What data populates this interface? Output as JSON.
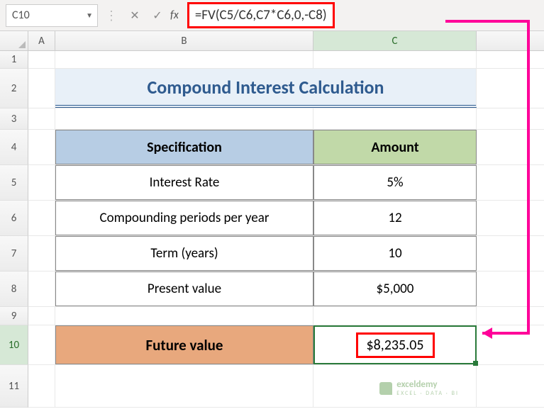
{
  "nameBox": {
    "value": "C10"
  },
  "formulaBar": {
    "formula": "=FV(C5/C6,C7*C6,0,-C8)"
  },
  "columns": {
    "A": "A",
    "B": "B",
    "C": "C"
  },
  "rows": [
    "1",
    "2",
    "3",
    "4",
    "5",
    "6",
    "7",
    "8",
    "9",
    "10",
    "11"
  ],
  "title": "Compound Interest Calculation",
  "headers": {
    "spec": "Specification",
    "amount": "Amount"
  },
  "data": [
    {
      "label": "Interest Rate",
      "value": "5%"
    },
    {
      "label": "Compounding periods per year",
      "value": "12"
    },
    {
      "label": "Term (years)",
      "value": "10"
    },
    {
      "label": "Present value",
      "value": "$5,000"
    }
  ],
  "future": {
    "label": "Future value",
    "value": "$8,235.05"
  },
  "watermark": {
    "name": "exceldemy",
    "tagline": "EXCEL · DATA · BI"
  },
  "chart_data": {
    "type": "table",
    "title": "Compound Interest Calculation",
    "columns": [
      "Specification",
      "Amount"
    ],
    "rows": [
      [
        "Interest Rate",
        "5%"
      ],
      [
        "Compounding periods per year",
        12
      ],
      [
        "Term (years)",
        10
      ],
      [
        "Present value",
        5000
      ]
    ],
    "computed": {
      "label": "Future value",
      "formula": "=FV(C5/C6,C7*C6,0,-C8)",
      "value": 8235.05
    }
  }
}
